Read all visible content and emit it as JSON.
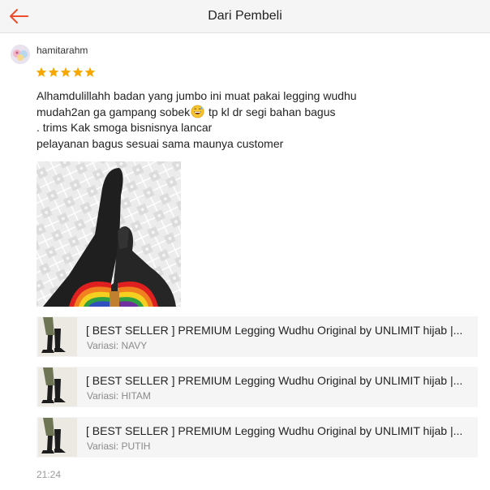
{
  "header": {
    "title": "Dari Pembeli",
    "back_icon": "arrow-left-icon",
    "accent": "#ee4d2d"
  },
  "review": {
    "username": "hamitarahm",
    "stars": 5,
    "star_color": "#f6a700",
    "text_lines": [
      "Alhamdulillahh badan yang jumbo ini muat pakai legging wudhu",
      "mudah2an ga gampang sobek",
      " tp kl dr segi bahan bagus",
      ". trims Kak smoga bisnisnya lancar",
      "pelayanan bagus sesuai sama maunya customer"
    ],
    "emoji": "grinning-sweat-emoji",
    "timestamp": "21:24"
  },
  "products": [
    {
      "name": "[ BEST SELLER ] PREMIUM Legging Wudhu Original by UNLIMIT hijab |...",
      "variant": "Variasi: NAVY"
    },
    {
      "name": "[ BEST SELLER ] PREMIUM Legging Wudhu Original by UNLIMIT hijab |...",
      "variant": "Variasi: HITAM"
    },
    {
      "name": "[ BEST SELLER ] PREMIUM Legging Wudhu Original by UNLIMIT hijab |...",
      "variant": "Variasi: PUTIH"
    }
  ]
}
